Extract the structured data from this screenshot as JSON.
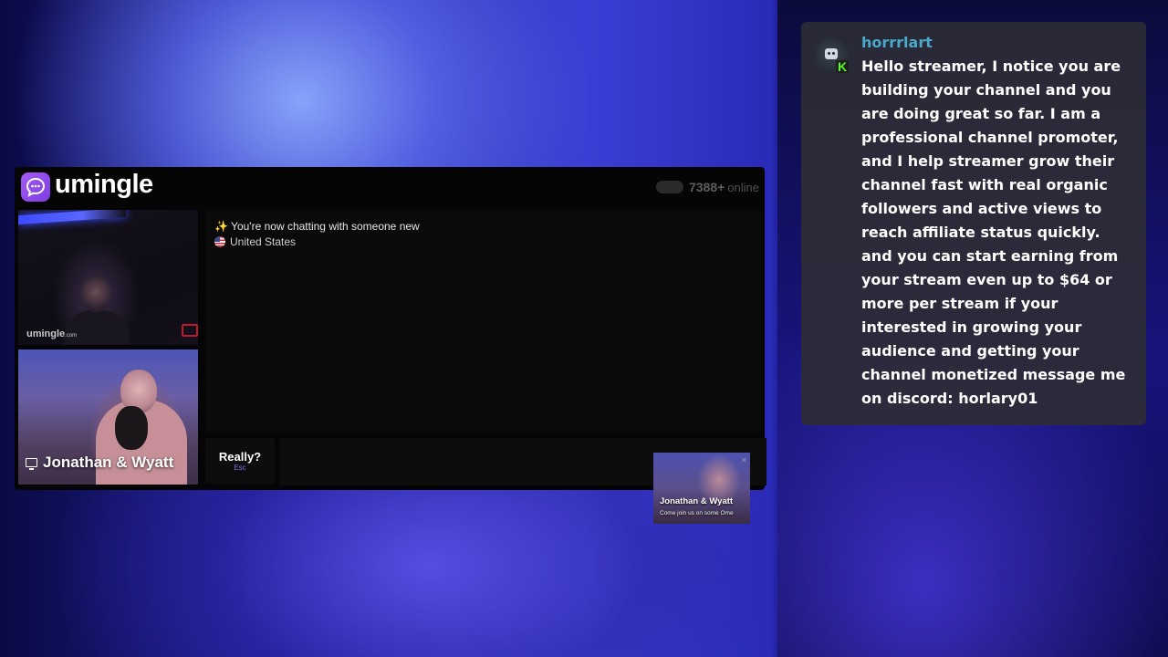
{
  "umingle": {
    "brand": "umingle",
    "online_count": "7388+",
    "online_label": "online",
    "watermark": "umingle",
    "watermark_suffix": ".com",
    "system_message": "✨ You're now chatting with someone new",
    "country": "United States",
    "local_cam_name": "Jonathan & Wyatt",
    "skip_button": {
      "label": "Really?",
      "shortcut": "Esc"
    },
    "message_placeholder": ""
  },
  "mini_cam": {
    "name": "Jonathan & Wyatt",
    "subtitle": "Come join us on some Ome"
  },
  "chat_message": {
    "username": "horrrlart",
    "badge": "K",
    "text": "Hello streamer, I notice you are building your channel and you are doing great so far. I am a professional channel promoter, and I help streamer grow their channel fast with real organic followers and active views to reach affiliate status quickly. and you can start earning from your stream even up to $64 or more per stream if your interested in growing your audience and getting your channel monetized message me on discord: horlary01",
    "username_color": "#4aa9c9",
    "badge_color": "#53fc18"
  }
}
